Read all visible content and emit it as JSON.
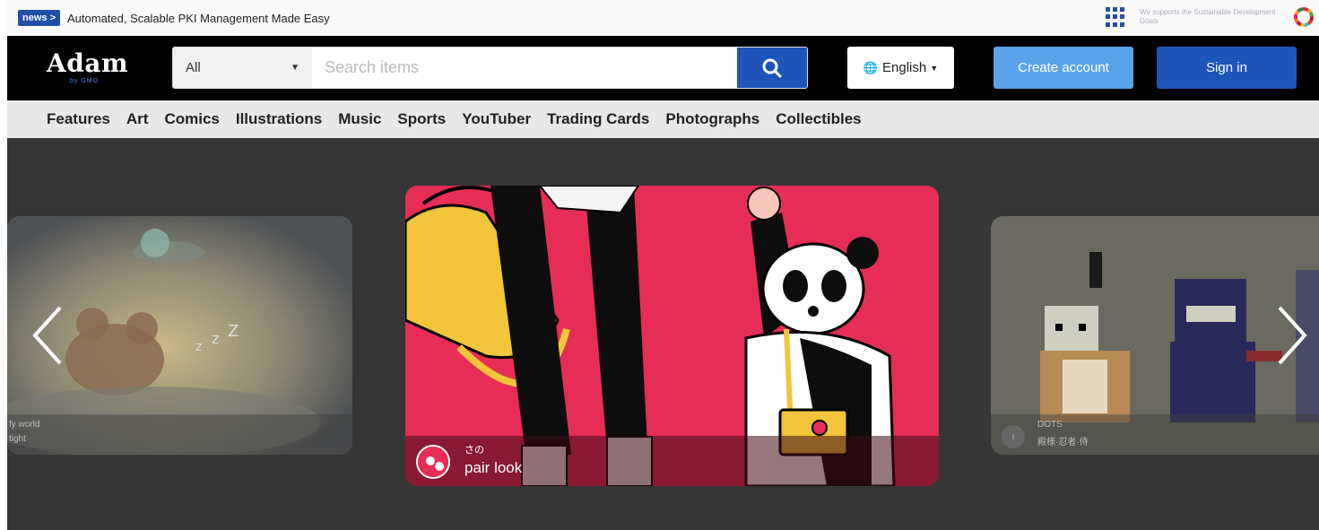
{
  "newsbar": {
    "badge": "news >",
    "text": "Automated, Scalable PKI Management Made Easy",
    "sdg_text": "We supports the Sustainable Development Goals"
  },
  "header": {
    "logo": "Adam",
    "logo_sub": "by GMO",
    "search": {
      "category": "All",
      "placeholder": "Search items"
    },
    "language": "English",
    "create_account": "Create account",
    "sign_in": "Sign in"
  },
  "catnav": {
    "items": [
      "Features",
      "Art",
      "Comics",
      "Illustrations",
      "Music",
      "Sports",
      "YouTuber",
      "Trading Cards",
      "Photographs",
      "Collectibles"
    ]
  },
  "carousel": {
    "left": {
      "author": "fy world",
      "title": "tight"
    },
    "center": {
      "author": "さの",
      "title": "pair look"
    },
    "right": {
      "author": "DOTS",
      "title": "殿様·忍者·侍"
    }
  },
  "colors": {
    "header_bg": "#000000",
    "accent_blue": "#1f55b8",
    "create_blue": "#5aa3ec",
    "featured_red": "#e62d55",
    "carousel_bg": "#363636"
  },
  "icons": {
    "search_button": "search-icon",
    "language": "globe-icon",
    "apps": "grid-icon",
    "prev": "chevron-left-icon",
    "next": "chevron-right-icon"
  }
}
